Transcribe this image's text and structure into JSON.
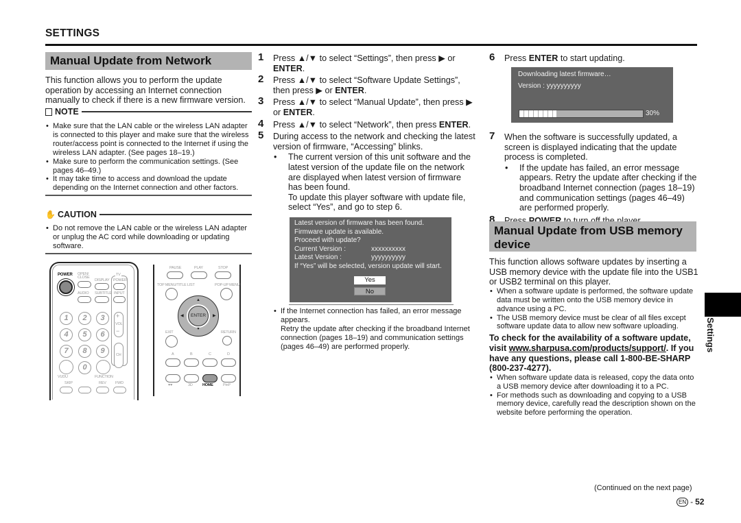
{
  "header": {
    "section": "SETTINGS"
  },
  "network": {
    "title": "Manual Update from Network",
    "intro": "This function allows you to perform the update operation by accessing an Internet connection manually to check if there is a new firmware version.",
    "note_label": "NOTE",
    "notes": [
      "Make sure that the LAN cable or the wireless LAN adapter is connected to this player and make sure that the wireless router/access point is connected to the Internet if using the wireless LAN adapter. (See pages 18–19.)",
      "Make sure to perform the communication settings. (See pages 46–49.)",
      "It may take time to access and download the update depending on the Internet connection and other factors."
    ],
    "caution_label": "CAUTION",
    "cautions": [
      "Do not remove the LAN cable or the wireless LAN adapter or unplug the AC cord while downloading or updating software."
    ]
  },
  "remote": {
    "left": {
      "power": "POWER",
      "open_close": "OPEN/ CLOSE",
      "display": "DISPLAY",
      "tv": "TV",
      "tv_power": "POWER",
      "audio": "AUDIO",
      "subtitle": "SUBTITLE",
      "input": "INPUT",
      "digits": [
        "1",
        "2",
        "3",
        "4",
        "5",
        "6",
        "7",
        "8",
        "9",
        "0"
      ],
      "vol": "VOL",
      "vol_plus": "+",
      "vol_minus": "−",
      "ch": "CH",
      "vudu": "VUDU",
      "function": "FUNCTION",
      "skip": "SKIP",
      "rev": "REV",
      "fwd": "FWD"
    },
    "right": {
      "pause": "PAUSE",
      "play": "PLAY",
      "stop": "STOP",
      "top_menu": "TOP MENU/TITLE LIST",
      "popup_menu": "POP-UP MENU",
      "enter": "ENTER",
      "exit": "EXIT",
      "return": "RETURN",
      "a": "A",
      "b": "B",
      "c": "C",
      "d": "D",
      "netflix": "♥♥",
      "three_d": "3D",
      "home": "HOME",
      "pinp": "PinP"
    }
  },
  "steps": [
    {
      "n": "1",
      "pre": "Press ▲/▼ to select “Settings”, then press ▶ or ",
      "bold": "ENTER",
      "post": "."
    },
    {
      "n": "2",
      "pre": "Press ▲/▼ to select “Software Update Settings”, then press ▶ or ",
      "bold": "ENTER",
      "post": "."
    },
    {
      "n": "3",
      "pre": "Press ▲/▼ to select “Manual Update”, then press ▶ or ",
      "bold": "ENTER",
      "post": "."
    },
    {
      "n": "4",
      "pre": "Press ▲/▼ to select “Network”, then press ",
      "bold": "ENTER",
      "post": "."
    },
    {
      "n": "5",
      "pre": "During access to the network and checking the latest version of firmware, “Accessing” blinks.",
      "bold": "",
      "post": ""
    }
  ],
  "step5_sub": [
    "The current version of this unit software and the latest version of the update file on the network are displayed when latest version of firmware has been found.",
    "To update this player software with update file, select “Yes”, and go to step 6."
  ],
  "found_dialog": {
    "lines": [
      "Latest version of firmware has been found.",
      "Firmware update is available.",
      "Proceed with update?"
    ],
    "current_label": "Current Version :",
    "current_value": "xxxxxxxxxx",
    "latest_label": "Latest Version  :",
    "latest_value": "yyyyyyyyyy",
    "footer": "If “Yes” will be selected, version update will start.",
    "yes": "Yes",
    "no": "No"
  },
  "failure_note": [
    "If the Internet connection has failed, an error message appears.",
    "Retry the update after checking if the broadband Internet connection (pages 18–19) and communication settings (pages 46–49) are performed properly."
  ],
  "step6": {
    "n": "6",
    "pre": "Press ",
    "bold": "ENTER",
    "post": " to start updating."
  },
  "download_dialog": {
    "line1": "Downloading latest firmware…",
    "version_label": "Version :",
    "version_value": "yyyyyyyyyy",
    "progress_percent": 30,
    "progress_label": "30%"
  },
  "step7": {
    "n": "7",
    "text": "When the software is successfully updated, a screen is displayed indicating that the update process is completed.",
    "sub": "If the update has failed, an error message appears. Retry the update after checking if the broadband Internet connection (pages 18–19) and communication settings (pages 46–49) are performed properly."
  },
  "step8": {
    "n": "8",
    "pre": "Press ",
    "bold": "POWER",
    "post": " to turn off the player."
  },
  "usb": {
    "title": "Manual Update from USB memory device",
    "intro": "This function allows software updates by inserting a USB memory device with the update file into the USB1 or USB2 terminal on this player.",
    "notes": [
      "When a software update is performed, the software update data must be written onto the USB memory device in advance using a PC.",
      "The USB memory device must be clear of all files except software update data to allow new software uploading."
    ],
    "check_pre": "To check for the availability of a software update, visit ",
    "check_link": "www.sharpusa.com/products/support/",
    "check_post": ". If you have any questions, please call 1-800-BE-SHARP (800-237-4277).",
    "notes2": [
      "When software update data is released, copy the data onto a USB memory device after downloading it to a PC.",
      "For methods such as downloading and copying to a USB memory device, carefully read the description shown on the website before performing the operation."
    ]
  },
  "side_tab": "Settings",
  "footer": {
    "continued": "(Continued on the next page)",
    "lang": "EN",
    "page": "52"
  }
}
